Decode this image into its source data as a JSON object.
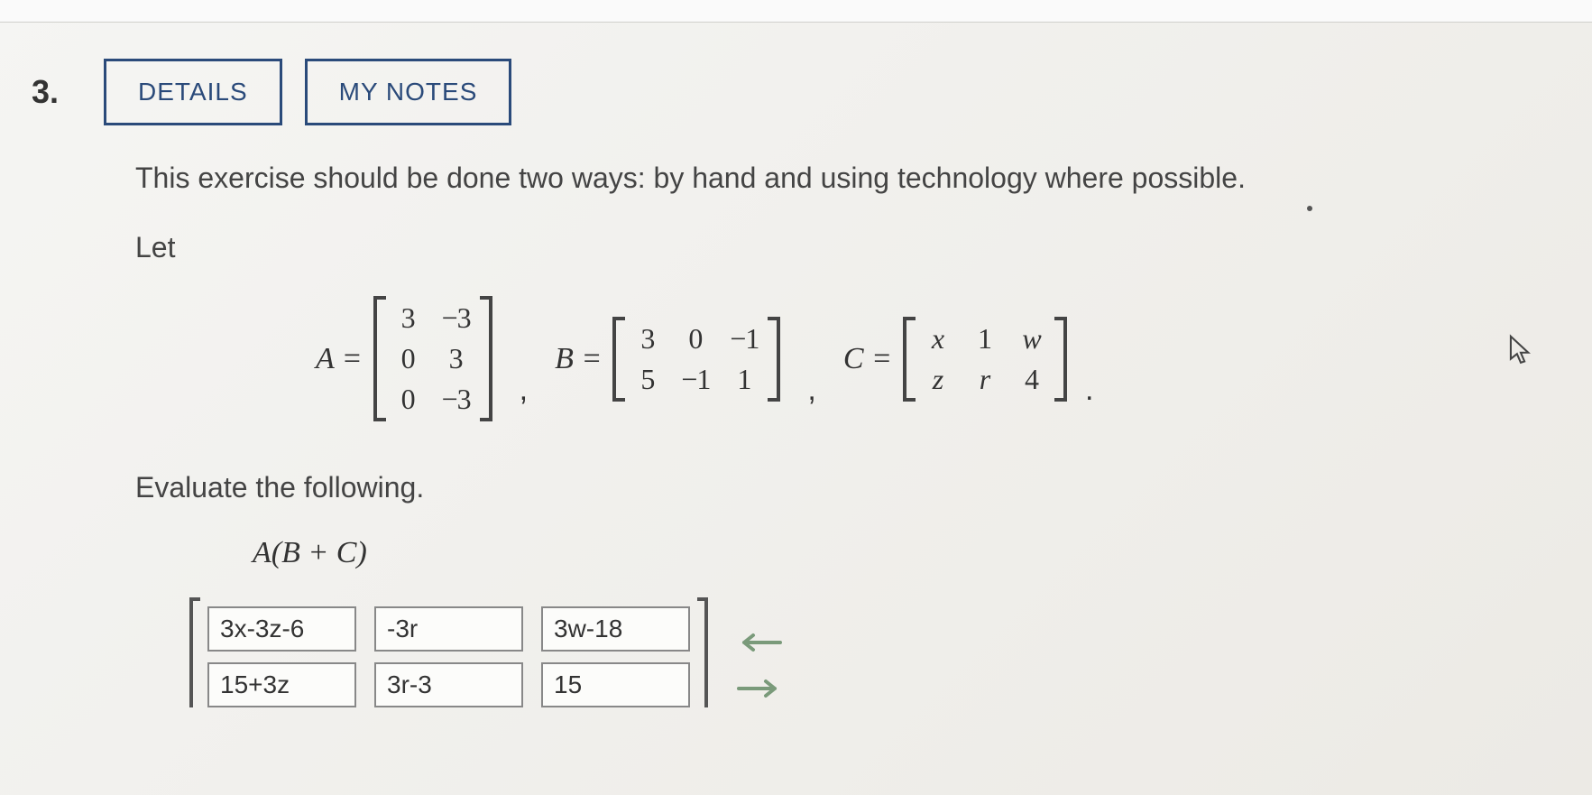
{
  "question": {
    "number": "3.",
    "buttons": {
      "details": "DETAILS",
      "notes": "MY NOTES"
    },
    "instruction": "This exercise should be done two ways: by hand and using technology where possible.",
    "let": "Let",
    "matrices": {
      "A": {
        "label": "A =",
        "rows": [
          [
            "3",
            "−3"
          ],
          [
            "0",
            "3"
          ],
          [
            "0",
            "−3"
          ]
        ]
      },
      "B": {
        "label": "B =",
        "rows": [
          [
            "3",
            "0",
            "−1"
          ],
          [
            "5",
            "−1",
            "1"
          ]
        ]
      },
      "C": {
        "label": "C =",
        "rows": [
          [
            "x",
            "1",
            "w"
          ],
          [
            "z",
            "r",
            "4"
          ]
        ]
      }
    },
    "evaluate": "Evaluate the following.",
    "expression": "A(B + C)",
    "answers": {
      "r0c0": "3x-3z-6",
      "r0c1": "-3r",
      "r0c2": "3w-18",
      "r1c0": "15+3z",
      "r1c1": "3r-3",
      "r1c2": "15"
    }
  }
}
